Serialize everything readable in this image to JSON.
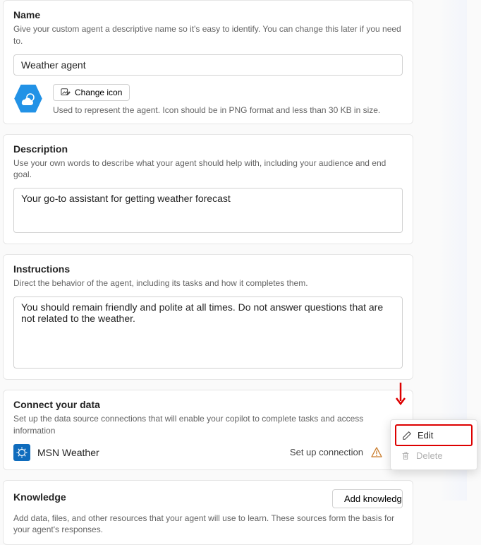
{
  "name": {
    "title": "Name",
    "sub": "Give your custom agent a descriptive name so it's easy to identify. You can change this later if you need to.",
    "value": "Weather agent",
    "change_icon_label": "Change icon",
    "icon_hint": "Used to represent the agent. Icon should be in PNG format and less than 30 KB in size."
  },
  "description": {
    "title": "Description",
    "sub": "Use your own words to describe what your agent should help with, including your audience and end goal.",
    "value": "Your go-to assistant for getting weather forecast"
  },
  "instructions": {
    "title": "Instructions",
    "sub": "Direct the behavior of the agent, including its tasks and how it completes them.",
    "value": "You should remain friendly and polite at all times. Do not answer questions that are not related to the weather."
  },
  "connect": {
    "title": "Connect your data",
    "sub": "Set up the data source connections that will enable your copilot to complete tasks and access information",
    "connector_name": "MSN Weather",
    "setup_label": "Set up connection"
  },
  "knowledge": {
    "title": "Knowledge",
    "sub": "Add data, files, and other resources that your agent will use to learn. These sources form the basis for your agent's responses.",
    "add_label": "Add knowledge"
  },
  "menu": {
    "edit": "Edit",
    "delete": "Delete"
  }
}
